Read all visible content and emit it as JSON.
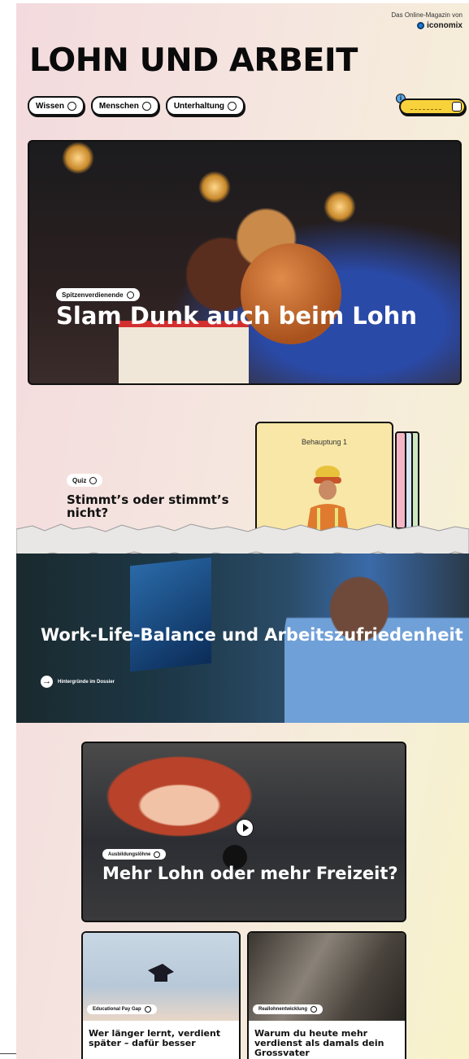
{
  "header": {
    "note": "Das Online-Magazin von",
    "brand": "iconomix",
    "title": "LOHN UND ARBEIT"
  },
  "nav": {
    "tags": [
      {
        "label": "Wissen",
        "icon": "lightbulb-icon"
      },
      {
        "label": "Menschen",
        "icon": "people-icon"
      },
      {
        "label": "Unterhaltung",
        "icon": "game-icon"
      }
    ]
  },
  "hero": {
    "tag": "Spitzenverdienende",
    "title": "Slam Dunk auch beim Lohn"
  },
  "quiz": {
    "tag": "Quiz",
    "title": "Stimmt’s oder stimmt’s nicht?",
    "card_label": "Behauptung 1"
  },
  "dossier": {
    "title": "Work-Life-Balance und Arbeitszufriedenheit",
    "link": "Hintergründe im Dossier"
  },
  "video": {
    "tag": "Ausbildungslöhne",
    "title": "Mehr Lohn oder mehr Freizeit?"
  },
  "cards": [
    {
      "tag": "Educational Pay Gap",
      "title": "Wer länger lernt, verdient später – dafür besser"
    },
    {
      "tag": "Reallohnentwicklung",
      "title": "Warum du heute mehr verdienst als damals dein Grossvater"
    }
  ],
  "colors": {
    "accent": "#f8d23a",
    "ink": "#111111"
  }
}
